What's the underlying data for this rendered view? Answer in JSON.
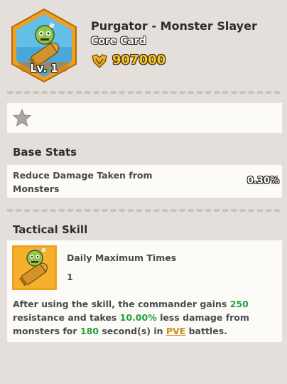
{
  "card": {
    "name": "Purgator - Monster Slayer",
    "type": "Core Card",
    "level": "Lv. 1",
    "price": "907000",
    "icon": "zombie-bullet-icon",
    "currency_icon": "gold-badge-icon"
  },
  "star_row": {
    "icon": "star-icon",
    "filled": false
  },
  "base_stats": {
    "title": "Base Stats",
    "label": "Reduce Damage Taken from Monsters",
    "value": "0.30%"
  },
  "tactical_skill": {
    "title": "Tactical Skill",
    "name": "Daily Maximum Times",
    "count": "1",
    "description": {
      "t1": "After using the skill, the commander gains ",
      "v1": "250",
      "t2": " resistance and takes ",
      "v2": "10.00%",
      "t3": " less damage from monsters for ",
      "v3": "180",
      "t4": " second(s) in ",
      "link": "PVE",
      "t5": " battles."
    }
  },
  "colors": {
    "background": "#e4dfda",
    "card_bg": "#fcfbf8",
    "hex_frame": "#f0a020",
    "hex_bg": "#4aa8d8",
    "price_gold": "#f7c623",
    "highlight_green": "#22a23c",
    "link_orange": "#d08a1a"
  }
}
